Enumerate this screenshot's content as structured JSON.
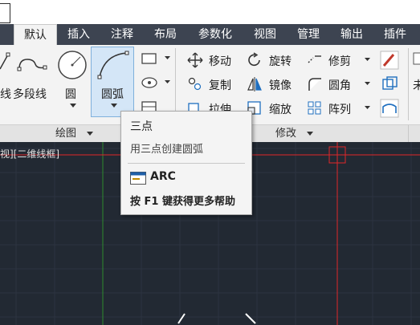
{
  "ribbon": {
    "tabs": [
      "默认",
      "插入",
      "注释",
      "布局",
      "参数化",
      "视图",
      "管理",
      "输出",
      "插件"
    ],
    "active_tab": "默认"
  },
  "draw_panel": {
    "items": [
      {
        "label": "线",
        "icon": "line-icon"
      },
      {
        "label": "多段线",
        "icon": "polyline-icon"
      },
      {
        "label": "圆",
        "icon": "circle-icon"
      },
      {
        "label": "圆弧",
        "icon": "arc-icon"
      }
    ],
    "panel_label": "绘图",
    "dropdown_icon": "triangle-down-icon"
  },
  "modify_panel": {
    "items": [
      {
        "label": "移动",
        "icon": "move-icon"
      },
      {
        "label": "旋转",
        "icon": "rotate-icon"
      },
      {
        "label": "修剪",
        "icon": "trim-icon"
      },
      {
        "label": "复制",
        "icon": "copy-icon"
      },
      {
        "label": "镜像",
        "icon": "mirror-icon"
      },
      {
        "label": "圆角",
        "icon": "fillet-icon"
      },
      {
        "label": "拉伸",
        "icon": "stretch-icon"
      },
      {
        "label": "缩放",
        "icon": "scale-icon"
      },
      {
        "label": "阵列",
        "icon": "array-icon"
      }
    ],
    "panel_label": "修改"
  },
  "right_edge_labels": [
    "未"
  ],
  "viewport": {
    "label": "视][二维线框]"
  },
  "tooltip": {
    "title": "三点",
    "description": "用三点创建圆弧",
    "command": "ARC",
    "help": "按 F1 键获得更多帮助"
  },
  "colors": {
    "ribbon_bg": "#f3f3f3",
    "tab_bar": "#3d4451",
    "canvas_bg": "#222933",
    "hover_bg": "#d4e6f7",
    "crosshair_red": "#e0262a",
    "axis_green": "#2e8b2e"
  }
}
